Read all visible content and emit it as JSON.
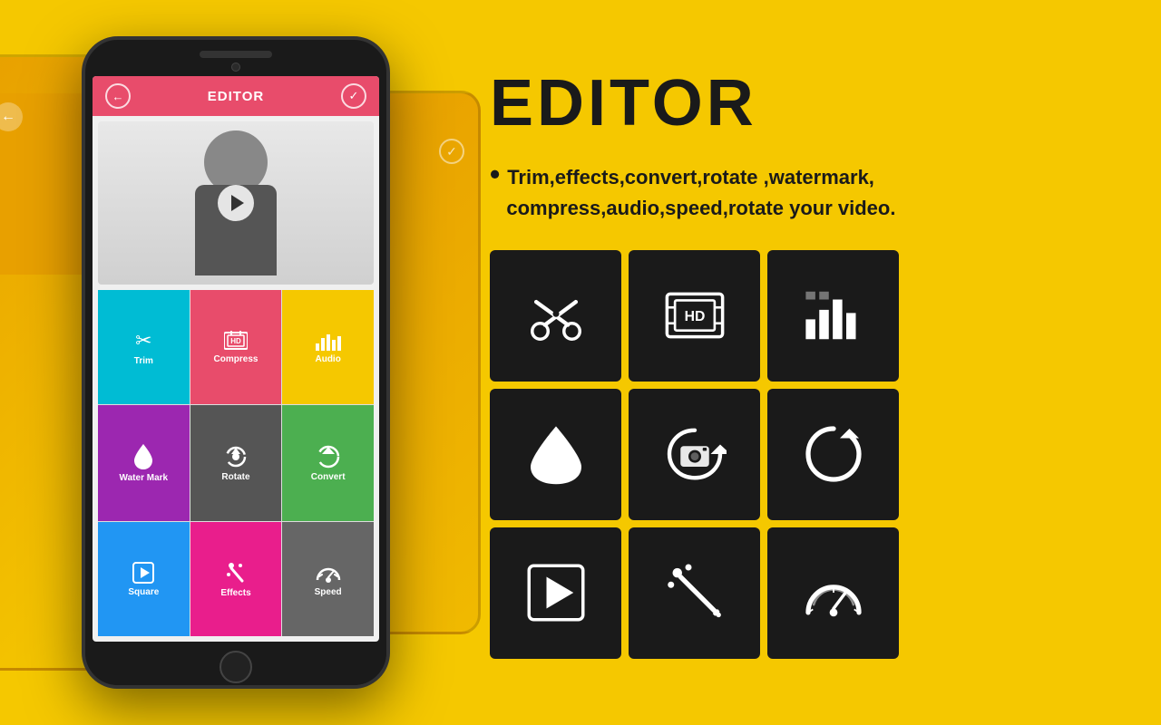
{
  "background_color": "#F5C800",
  "phone": {
    "header": {
      "title": "EDITOR",
      "back_label": "←",
      "check_label": "✓"
    },
    "tools": [
      {
        "id": "trim",
        "label": "Trim",
        "color": "btn-teal",
        "icon": "scissors"
      },
      {
        "id": "compress",
        "label": "Compress",
        "color": "btn-pink",
        "icon": "compress"
      },
      {
        "id": "audio",
        "label": "Audio",
        "color": "btn-yellow",
        "icon": "audio"
      },
      {
        "id": "watermark",
        "label": "Water Mark",
        "color": "btn-purple",
        "icon": "watermark"
      },
      {
        "id": "rotate",
        "label": "Rotate",
        "color": "btn-gray",
        "icon": "rotate"
      },
      {
        "id": "convert",
        "label": "Convert",
        "color": "btn-green",
        "icon": "convert"
      },
      {
        "id": "square",
        "label": "Square",
        "color": "btn-blue",
        "icon": "square"
      },
      {
        "id": "effects",
        "label": "Effects",
        "color": "btn-magenta",
        "icon": "effects"
      },
      {
        "id": "speed",
        "label": "Speed",
        "color": "btn-darkgray",
        "icon": "speed"
      }
    ]
  },
  "right_panel": {
    "title": "EDITOR",
    "feature_bullet": "•",
    "feature_text": "Trim,effects,convert,rotate ,watermark,\ncompress,audio,speed,rotate your video.",
    "icon_grid": [
      {
        "id": "trim",
        "label": "Trim - scissors icon"
      },
      {
        "id": "compress",
        "label": "Compress - video frame icon"
      },
      {
        "id": "audio",
        "label": "Audio - bars icon"
      },
      {
        "id": "watermark",
        "label": "Water mark - drop icon"
      },
      {
        "id": "rotate-video",
        "label": "Rotate video - camera rotate icon"
      },
      {
        "id": "convert-arrow",
        "label": "Convert - rotate arrow icon"
      },
      {
        "id": "square-play",
        "label": "Square - play icon"
      },
      {
        "id": "effects-wand",
        "label": "Effects - magic wand icon"
      },
      {
        "id": "speed-gauge",
        "label": "Speed - gauge icon"
      }
    ]
  }
}
